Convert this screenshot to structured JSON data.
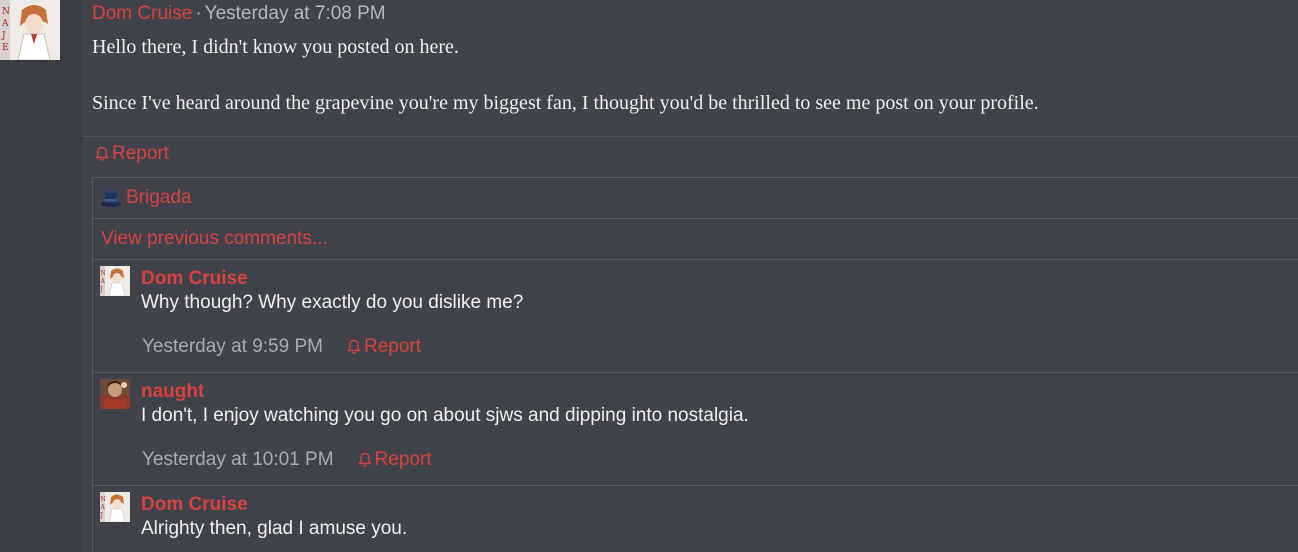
{
  "post": {
    "author": "Dom Cruise",
    "separator": "·",
    "time": "Yesterday at 7:08 PM",
    "body": [
      "Hello there, I didn't know you posted on here.",
      "Since I've heard around the grapevine you're my biggest fan, I thought you'd be thrilled to see me post on your profile."
    ],
    "report_label": "Report",
    "icon": "bell-icon"
  },
  "likes": {
    "icon": "top-hat-icon",
    "name": "Brigada"
  },
  "view_previous_label": "View previous comments...",
  "comments": [
    {
      "author": "Dom Cruise",
      "text": "Why though? Why exactly do you dislike me?",
      "time": "Yesterday at 9:59 PM",
      "report_label": "Report"
    },
    {
      "author": "naught",
      "text": "I don't, I enjoy watching you go on about sjws and dipping into nostalgia.",
      "time": "Yesterday at 10:01 PM",
      "report_label": "Report"
    },
    {
      "author": "Dom Cruise",
      "text": "Alrighty then, glad I amuse you."
    }
  ],
  "colors": {
    "accent": "#d8413b",
    "panel": "#40434b",
    "background": "#3a3d44",
    "text": "#f0f0f0"
  }
}
